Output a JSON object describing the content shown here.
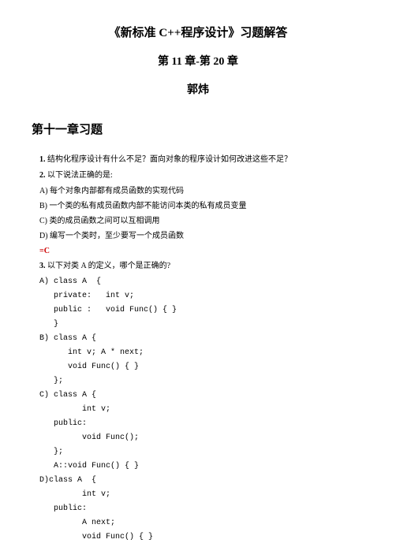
{
  "title_main": "《新标准 C++程序设计》习题解答",
  "title_sub": "第 11 章-第 20 章",
  "title_author": "郭炜",
  "section_heading": "第十一章习题",
  "q1_num": "1.",
  "q1_text": " 结构化程序设计有什么不足？面向对象的程序设计如何改进这些不足？",
  "q2_num": "2.",
  "q2_text": " 以下说法正确的是:",
  "q2_a": "A) 每个对象内部都有成员函数的实现代码",
  "q2_b": "B) 一个类的私有成员函数内部不能访问本类的私有成员变量",
  "q2_c": "C) 类的成员函数之间可以互相调用",
  "q2_d": "D) 编写一个类时，至少要写一个成员函数",
  "red_c": "=C",
  "q3_num": "3.",
  "q3_text": " 以下对类 A 的定义，哪个是正确的?",
  "q3a_head": "A) class A  {",
  "q3a_l1": "private:   int v;",
  "q3a_l2": "public :   void Func() { }",
  "q3a_l3": "}",
  "q3b_head": "B) class A {",
  "q3b_l1": "int v; A * next;",
  "q3b_l2": "void Func() { }",
  "q3b_l3": "};",
  "q3c_head": "C) class A {",
  "q3c_l1": "int v;",
  "q3c_l2": "public:",
  "q3c_l3": "void Func();",
  "q3c_l4": "};",
  "q3c_l5": "A::void Func() { }",
  "q3d_head": "D)class A  {",
  "q3d_l1": "int v;",
  "q3d_l2": "public:",
  "q3d_l3": "A next;",
  "q3d_l4": "void Func() { }"
}
